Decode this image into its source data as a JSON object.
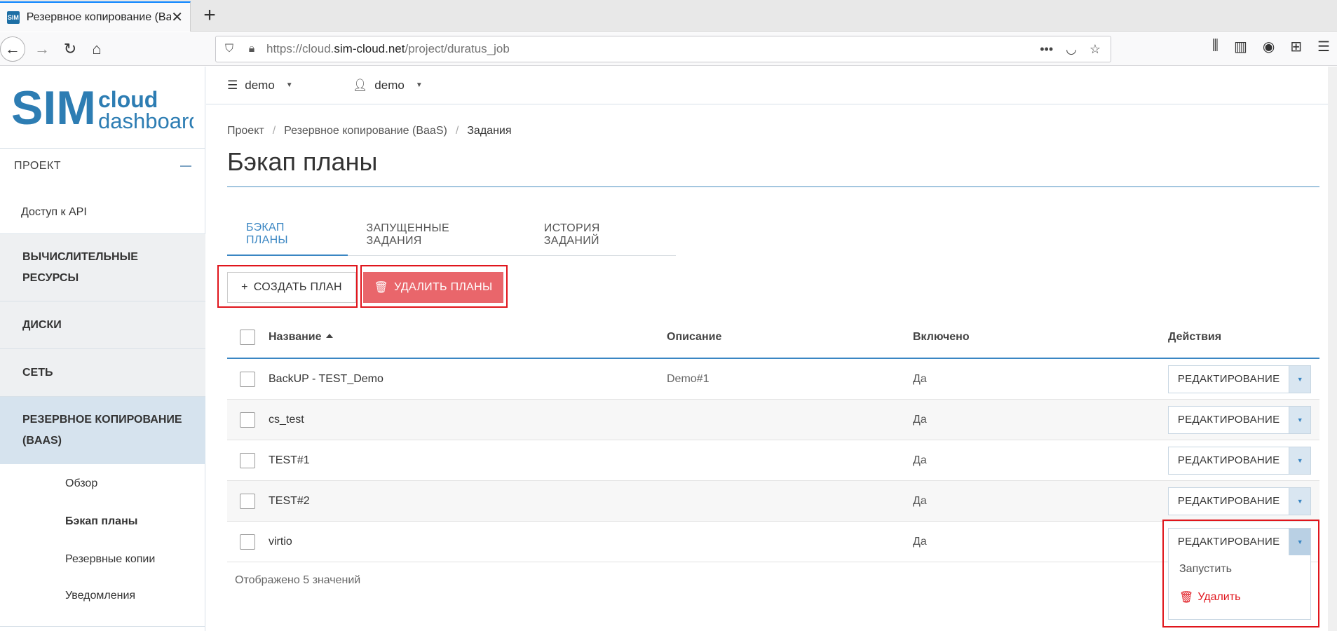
{
  "browser": {
    "tab_title": "Резервное копирование (Ba",
    "favicon": "SIM",
    "url_prefix": "https://cloud.",
    "url_domain": "sim-cloud.net",
    "url_path": "/project/duratus_job"
  },
  "logo": {
    "brand": "SIM",
    "line1": "cloud",
    "line2": "dashboard"
  },
  "topbar": {
    "project": "demo",
    "user": "demo"
  },
  "sidebar": {
    "project_label": "ПРОЕКТ",
    "api_access": "Доступ к API",
    "groups": {
      "compute_line1": "ВЫЧИСЛИТЕЛЬНЫЕ",
      "compute_line2": "РЕСУРСЫ",
      "disks": "ДИСКИ",
      "network": "СЕТЬ",
      "backup_line1": "РЕЗЕРВНОЕ КОПИРОВАНИЕ",
      "backup_line2": "(BAAS)"
    },
    "sub_items": [
      "Обзор",
      "Бэкап планы",
      "Резервные копии",
      "Уведомления"
    ]
  },
  "breadcrumb": [
    "Проект",
    "Резервное копирование (BaaS)",
    "Задания"
  ],
  "page_title": "Бэкап планы",
  "tabs": [
    "БЭКАП ПЛАНЫ",
    "ЗАПУЩЕННЫЕ ЗАДАНИЯ",
    "ИСТОРИЯ ЗАДАНИЙ"
  ],
  "actions": {
    "create": "СОЗДАТЬ ПЛАН",
    "delete": "УДАЛИТЬ ПЛАНЫ"
  },
  "table": {
    "columns": [
      "Название",
      "Описание",
      "Включено",
      "Действия"
    ],
    "rows": [
      {
        "name": "BackUP - TEST_Demo",
        "description": "Demo#1",
        "enabled": "Да",
        "action": "РЕДАКТИРОВАНИЕ"
      },
      {
        "name": "cs_test",
        "description": "",
        "enabled": "Да",
        "action": "РЕДАКТИРОВАНИЕ"
      },
      {
        "name": "TEST#1",
        "description": "",
        "enabled": "Да",
        "action": "РЕДАКТИРОВАНИЕ"
      },
      {
        "name": "TEST#2",
        "description": "",
        "enabled": "Да",
        "action": "РЕДАКТИРОВАНИЕ"
      },
      {
        "name": "virtio",
        "description": "",
        "enabled": "Да",
        "action": "РЕДАКТИРОВАНИЕ"
      }
    ],
    "footer": "Отображено 5 значений"
  },
  "row_menu": {
    "run": "Запустить",
    "delete": "Удалить"
  },
  "colors": {
    "accent": "#3a86c3",
    "danger": "#e9666b",
    "highlight": "#e0151c",
    "active_group": "#d6e3ee"
  }
}
